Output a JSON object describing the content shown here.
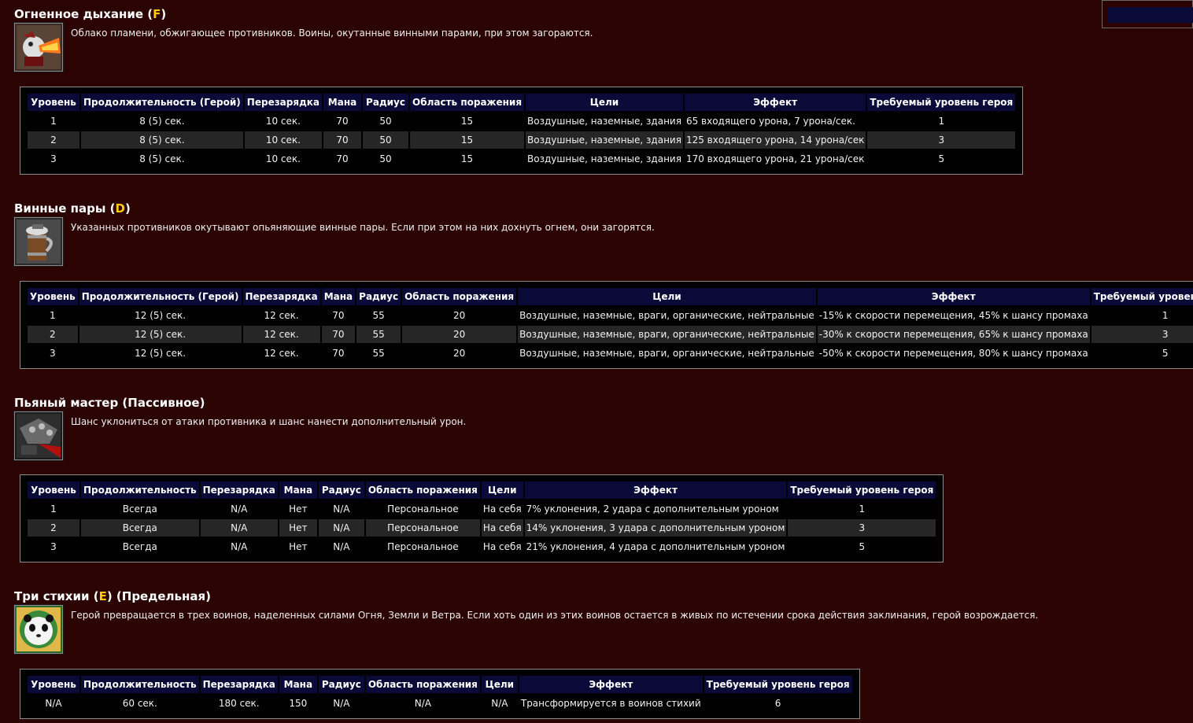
{
  "columns_full": [
    "Уровень",
    "Продолжительность (Герой)",
    "Перезарядка",
    "Мана",
    "Радиус",
    "Область поражения",
    "Цели",
    "Эффект",
    "Требуемый уровень героя"
  ],
  "columns_short": [
    "Уровень",
    "Продолжительность",
    "Перезарядка",
    "Мана",
    "Радиус",
    "Область поражения",
    "Цели",
    "Эффект",
    "Требуемый уровень героя"
  ],
  "abilities": [
    {
      "title": "Огненное дыхание (",
      "hotkey": "F",
      "title_suffix": ")",
      "icon": "fire-breath-icon",
      "description": "Облако пламени, обжигающее противников. Воины, окутанные винными парами, при этом загораются.",
      "rows": [
        [
          "1",
          "8 (5) сек.",
          "10 сек.",
          "70",
          "50",
          "15",
          "Воздушные, наземные, здания",
          "65 входящего урона, 7 урона/сек.",
          "1"
        ],
        [
          "2",
          "8 (5) сек.",
          "10 сек.",
          "70",
          "50",
          "15",
          "Воздушные, наземные, здания",
          "125 входящего урона, 14 урона/сек",
          "3"
        ],
        [
          "3",
          "8 (5) сек.",
          "10 сек.",
          "70",
          "50",
          "15",
          "Воздушные, наземные, здания",
          "170 входящего урона, 21 урона/сек",
          "5"
        ]
      ]
    },
    {
      "title": "Винные пары (",
      "hotkey": "D",
      "title_suffix": ")",
      "icon": "drunken-haze-icon",
      "description": "Указанных противников окутывают опьяняющие винные пары. Если при этом на них дохнуть огнем, они загорятся.",
      "rows": [
        [
          "1",
          "12 (5) сек.",
          "12 сек.",
          "70",
          "55",
          "20",
          "Воздушные, наземные, враги, органические, нейтральные",
          "-15% к скорости перемещения, 45% к шансу промаха",
          "1"
        ],
        [
          "2",
          "12 (5) сек.",
          "12 сек.",
          "70",
          "55",
          "20",
          "Воздушные, наземные, враги, органические, нейтральные",
          "-30% к скорости перемещения, 65% к шансу промаха",
          "3"
        ],
        [
          "3",
          "12 (5) сек.",
          "12 сек.",
          "70",
          "55",
          "20",
          "Воздушные, наземные, враги, органические, нейтральные",
          "-50% к скорости перемещения, 80% к шансу промаха",
          "5"
        ]
      ]
    },
    {
      "title": "Пьяный мастер (Пассивное)",
      "hotkey": "",
      "title_suffix": "",
      "icon": "drunken-brawler-icon",
      "description": "Шанс уклониться от атаки противника и шанс нанести дополнительный урон.",
      "rows": [
        [
          "1",
          "Всегда",
          "N/A",
          "Нет",
          "N/A",
          "Персональное",
          "На себя",
          "7% уклонения, 2 удара с дополнительным уроном",
          "1"
        ],
        [
          "2",
          "Всегда",
          "N/A",
          "Нет",
          "N/A",
          "Персональное",
          "На себя",
          "14% уклонения, 3 удара с дополнительным уроном",
          "3"
        ],
        [
          "3",
          "Всегда",
          "N/A",
          "Нет",
          "N/A",
          "Персональное",
          "На себя",
          "21% уклонения, 4 удара с дополнительным уроном",
          "5"
        ]
      ]
    },
    {
      "title": "Три стихии (",
      "hotkey": "E",
      "title_suffix": ") (Предельная)",
      "icon": "storm-earth-fire-icon",
      "description": "Герой превращается в трех воинов, наделенных силами Огня, Земли и Ветра. Если хоть один из этих воинов остается в живых по истечении срока действия заклинания, герой возрождается.",
      "rows": [
        [
          "N/A",
          "60 сек.",
          "180 сек.",
          "150",
          "N/A",
          "N/A",
          "N/A",
          "Трансформируется в воинов стихий",
          "6"
        ]
      ]
    }
  ]
}
